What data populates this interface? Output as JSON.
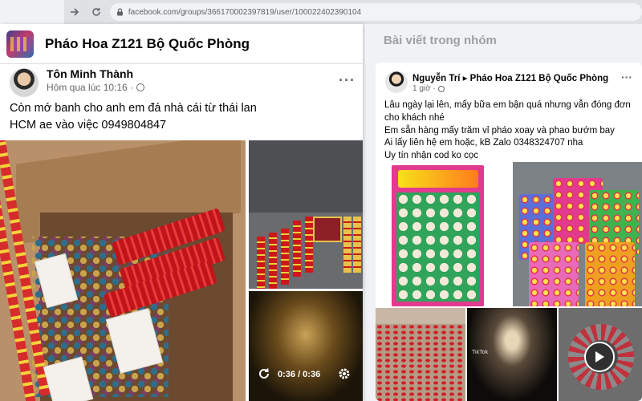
{
  "browser": {
    "url": "facebook.com/groups/366170002397819/user/100022402390104"
  },
  "popup": {
    "group_name": "Pháo Hoa Z121 Bộ Quốc Phòng",
    "author": "Tôn Minh Thành",
    "time": "Hôm qua lúc 10:16 ·",
    "more": "···",
    "text_line1": "Còn mớ banh cho anh em đá nhà cái từ thái lan",
    "text_line2": "HCM ae vào việc 0949804847",
    "video_time": "0:36 / 0:36"
  },
  "feed": {
    "header": "Bài viết trong nhóm",
    "post": {
      "author": "Nguyễn Trí",
      "separator": "▸",
      "group": "Pháo Hoa Z121 Bộ Quốc Phòng",
      "time": "1 giờ ·",
      "more": "···",
      "line1": "Lâu ngày lại lên, mấy bữa em bận quá nhưng vẫn đóng đơn cho khách nhé",
      "line2": "Em sẵn hàng mấy trăm vỉ pháo xoay và phao bướm bay",
      "line3": "Ai lấy liên hệ em hoặc, kB Zalo 0348324707 nha",
      "line4": "Uy tín nhận cod ko cọc",
      "tiktok_label": "TikTok"
    }
  }
}
